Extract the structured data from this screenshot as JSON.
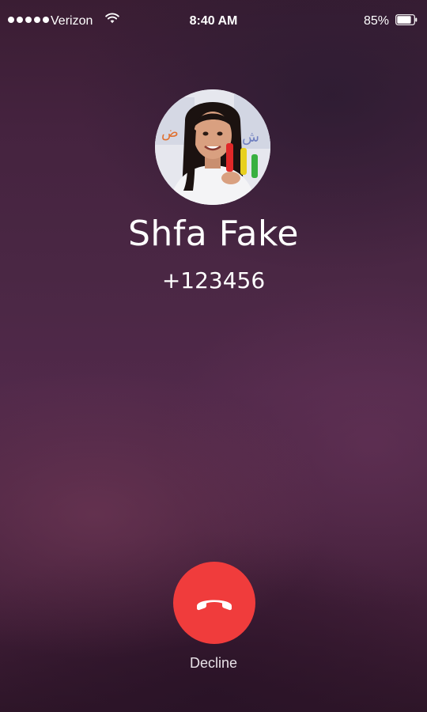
{
  "status_bar": {
    "carrier": "Verizon",
    "time": "8:40 AM",
    "battery_percent": "85%",
    "battery_level": 0.85,
    "signal_bars": 5
  },
  "call": {
    "contact_name": "Shfa Fake",
    "phone_number": "+123456"
  },
  "actions": {
    "decline_label": "Decline"
  },
  "colors": {
    "decline": "#f03c3c",
    "text": "#ffffff"
  }
}
